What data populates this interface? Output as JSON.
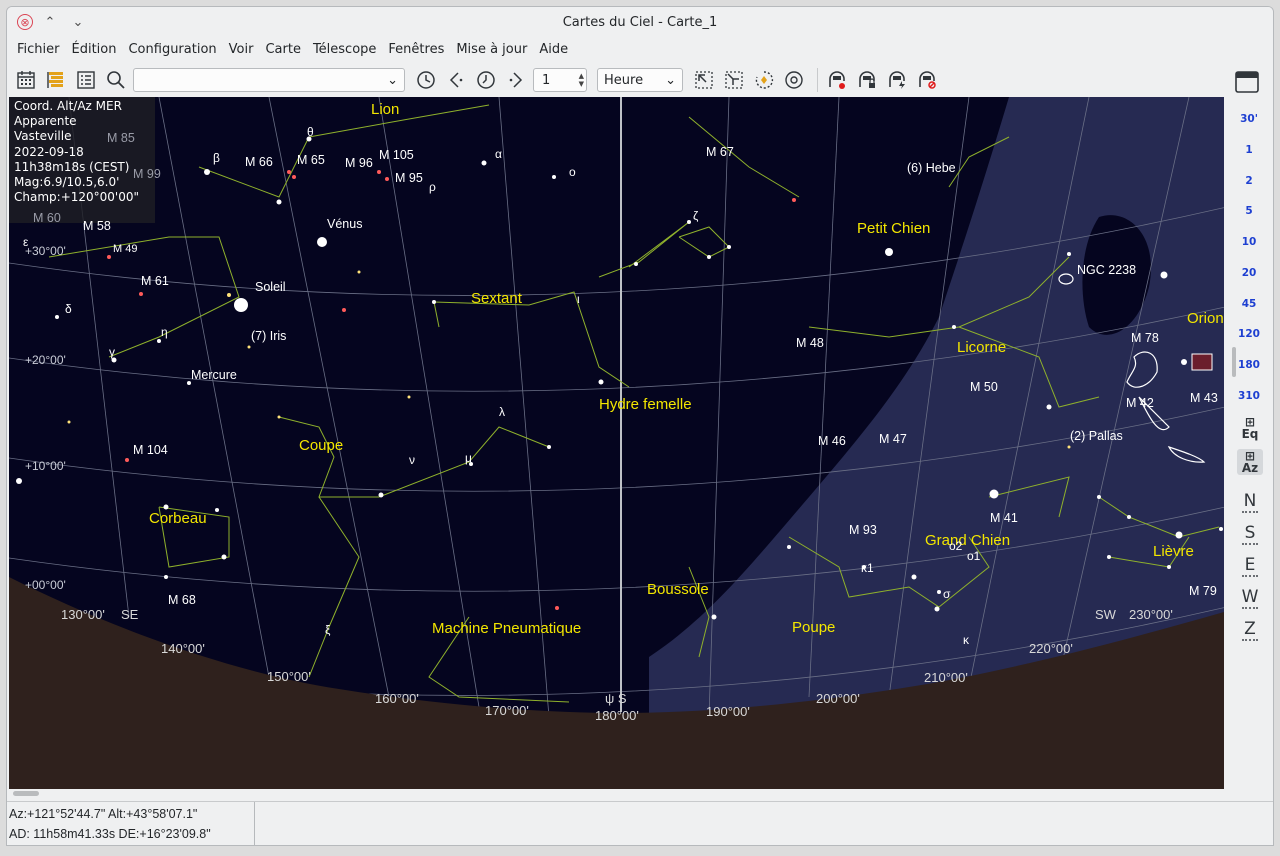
{
  "window": {
    "title": "Cartes du Ciel - Carte_1",
    "close_glyph": "⊗",
    "min_glyph": "⌃",
    "max_glyph": "⌄"
  },
  "menu": [
    "Fichier",
    "Édition",
    "Configuration",
    "Voir",
    "Carte",
    "Télescope",
    "Fenêtres",
    "Mise à jour",
    "Aide"
  ],
  "toolbar": {
    "search_value": "",
    "step_value": "1",
    "unit_value": "Heure",
    "icons": [
      "calendar-icon",
      "list-icon",
      "details-icon",
      "search-icon",
      "clock-icon",
      "step-back-icon",
      "now-icon",
      "step-forward-icon",
      "zoom-in-icon",
      "zoom-out-icon",
      "rotate-icon",
      "center-icon",
      "telescope-connect-icon",
      "telescope-lock-icon",
      "telescope-sync-icon",
      "telescope-abort-icon"
    ]
  },
  "info": {
    "lines": [
      "Coord. Alt/Az MER",
      "Apparente",
      "Vasteville",
      "2022-09-18",
      "11h38m18s (CEST)",
      "Mag:6.9/10.5,6.0'",
      "Champ:+120°00'00\""
    ]
  },
  "zoom_levels": [
    "30'",
    "1",
    "2",
    "5",
    "10",
    "20",
    "45",
    "120",
    "180",
    "310"
  ],
  "side_tools": {
    "eq": "Eq",
    "az": "Az",
    "dirs": [
      "N",
      "S",
      "E",
      "W",
      "Z"
    ]
  },
  "sky": {
    "constellations": [
      "Lion",
      "Sextant",
      "Coupe",
      "Corbeau",
      "Hydre femelle",
      "Machine Pneumatique",
      "Boussole",
      "Poupe",
      "Grand Chien",
      "Licorne",
      "Petit Chien",
      "Orion",
      "Lièvre"
    ],
    "objects": [
      "M 85",
      "M 99",
      "M 60",
      "M 58",
      "M 49",
      "M 61",
      "M 66",
      "M 65",
      "M 96",
      "M 105",
      "M 95",
      "M 67",
      "M 48",
      "M 50",
      "M 46",
      "M 47",
      "M 93",
      "M 41",
      "M 42",
      "M 43",
      "M 78",
      "M 104",
      "M 68",
      "M 79",
      "NGC 2238",
      "Vénus",
      "Soleil",
      "(7) Iris",
      "Mercure",
      "(6) Hebe",
      "(2) Pallas"
    ],
    "greek": [
      "θ",
      "β",
      "ρ",
      "ο",
      "α",
      "η",
      "γ",
      "δ",
      "ε",
      "λ",
      "μ",
      "ν",
      "ζ",
      "ξ",
      "κ",
      "σ",
      "ι",
      "ψ",
      "κ1",
      "ο1",
      "ο2"
    ],
    "grid": [
      "+30°00'",
      "+20°00'",
      "+10°00'",
      "+00°00'"
    ],
    "azimuth": [
      "130°00'",
      "SE",
      "140°00'",
      "150°00'",
      "160°00'",
      "170°00'",
      "ψ S",
      "180°00'",
      "190°00'",
      "200°00'",
      "210°00'",
      "220°00'",
      "SW",
      "230°00'"
    ]
  },
  "status": {
    "altaz": "Az:+121°52'44.7\" Alt:+43°58'07.1\"",
    "radec": "AD: 11h58m41.33s DE:+16°23'09.8\""
  },
  "colors": {
    "sky": "#05051f",
    "milky_way": "#262a52",
    "horizon": "#2f211d",
    "constellation_line": "#8fb12c",
    "constellation_label": "#f3e600",
    "zoom_label": "#1d3fd1"
  }
}
